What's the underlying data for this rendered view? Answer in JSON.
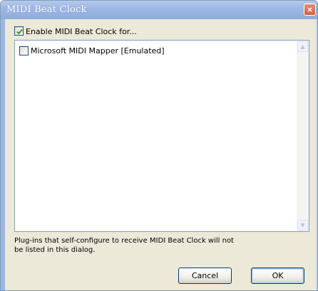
{
  "window": {
    "title": "MIDI Beat Clock",
    "close_glyph": "×"
  },
  "enable_checkbox": {
    "label": "Enable MIDI Beat Clock for...",
    "checked": true
  },
  "device_list": {
    "items": [
      {
        "label": "Microsoft MIDI Mapper [Emulated]",
        "checked": false
      }
    ]
  },
  "note": {
    "line1": "Plug-ins that self-configure to receive MIDI Beat Clock will not",
    "line2": "be listed in this dialog."
  },
  "buttons": {
    "cancel": "Cancel",
    "ok": "OK"
  },
  "icons": {
    "close": "close-icon",
    "check": "checkmark-icon",
    "scroll_up": "chevron-up-icon",
    "scroll_down": "chevron-down-icon"
  },
  "colors": {
    "title_bar": "#9db7e3",
    "dialog_face": "#ece9d8",
    "check_mark": "#21a121",
    "button_border": "#003c74"
  }
}
